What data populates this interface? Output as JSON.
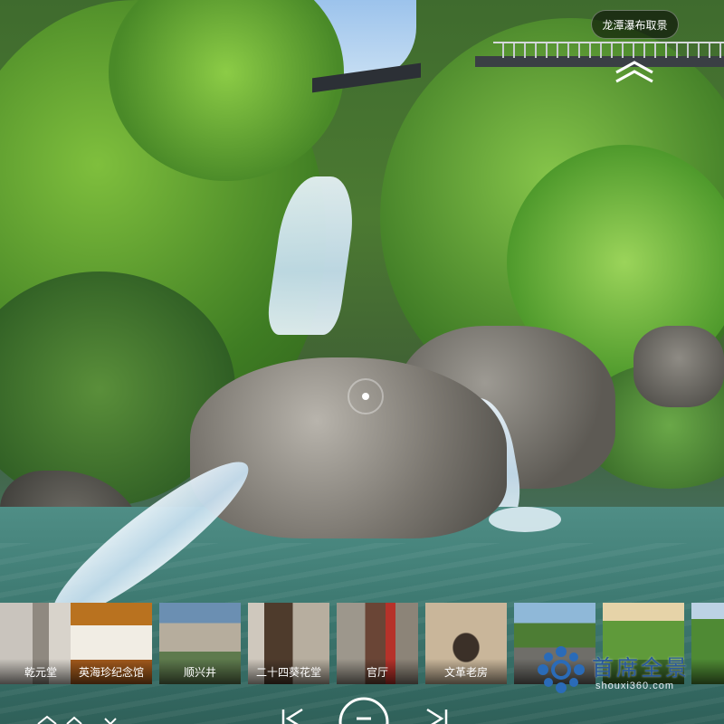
{
  "scene_button": {
    "label": "龙潭瀑布取景"
  },
  "thumbnails": [
    {
      "label": "乾元堂"
    },
    {
      "label": "英海珍纪念馆"
    },
    {
      "label": "顺兴井"
    },
    {
      "label": "二十四葵花堂"
    },
    {
      "label": "官厅"
    },
    {
      "label": "文革老房"
    },
    {
      "label": ""
    },
    {
      "label": ""
    },
    {
      "label": ""
    }
  ],
  "brand": {
    "name": "首席全景",
    "domain": "shouxi360.com"
  },
  "icons": {
    "scene_up": "double-chevron-up-icon",
    "prev": "skip-previous-icon",
    "play": "play-pause-icon",
    "next": "skip-next-icon",
    "gyro": "gyroscope-icon"
  },
  "colors": {
    "brand": "#2a5a9a",
    "hotspot": "#ffffff"
  }
}
